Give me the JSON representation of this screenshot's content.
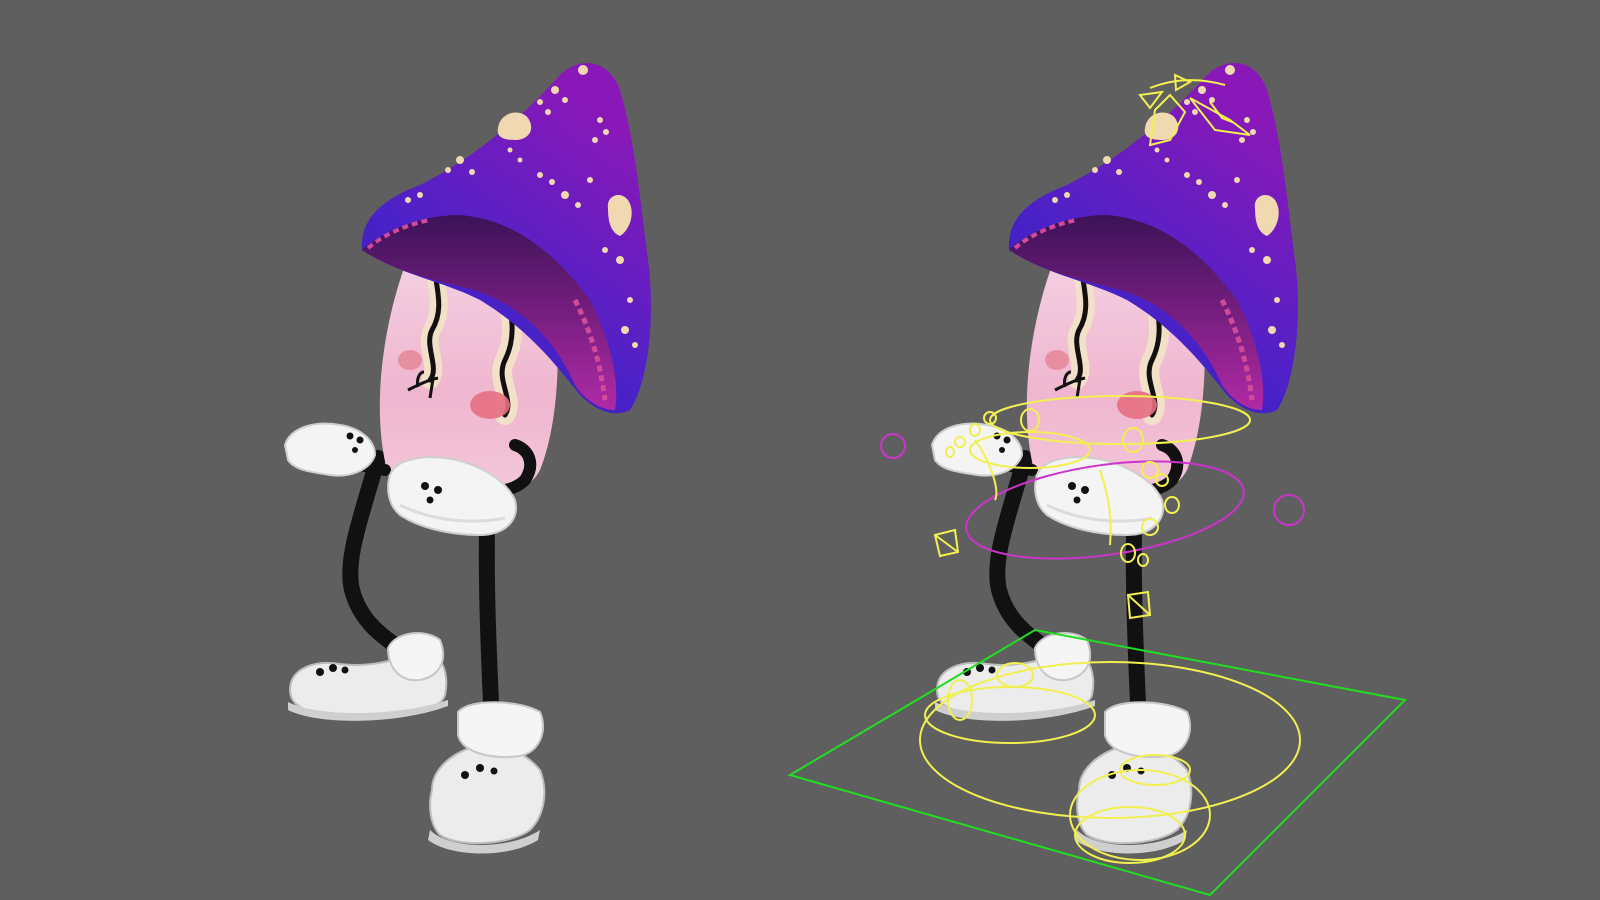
{
  "viewport": {
    "background": "#5f5f5f",
    "panel": "3d-viewport"
  },
  "character": {
    "name_visible": "",
    "cap_colors": [
      "#3a1fb8",
      "#7a1ab0",
      "#4c2bd0"
    ],
    "cap_spot_color": "#f0d8b0",
    "stem_color": "#f2c2d8",
    "cheek_color": "#e8707a",
    "glove_color": "#f4f4f4",
    "limb_color": "#111111"
  },
  "rig": {
    "control_color": "#f2f050",
    "ik_color": "#cc33cc",
    "root_color": "#22dd22"
  }
}
